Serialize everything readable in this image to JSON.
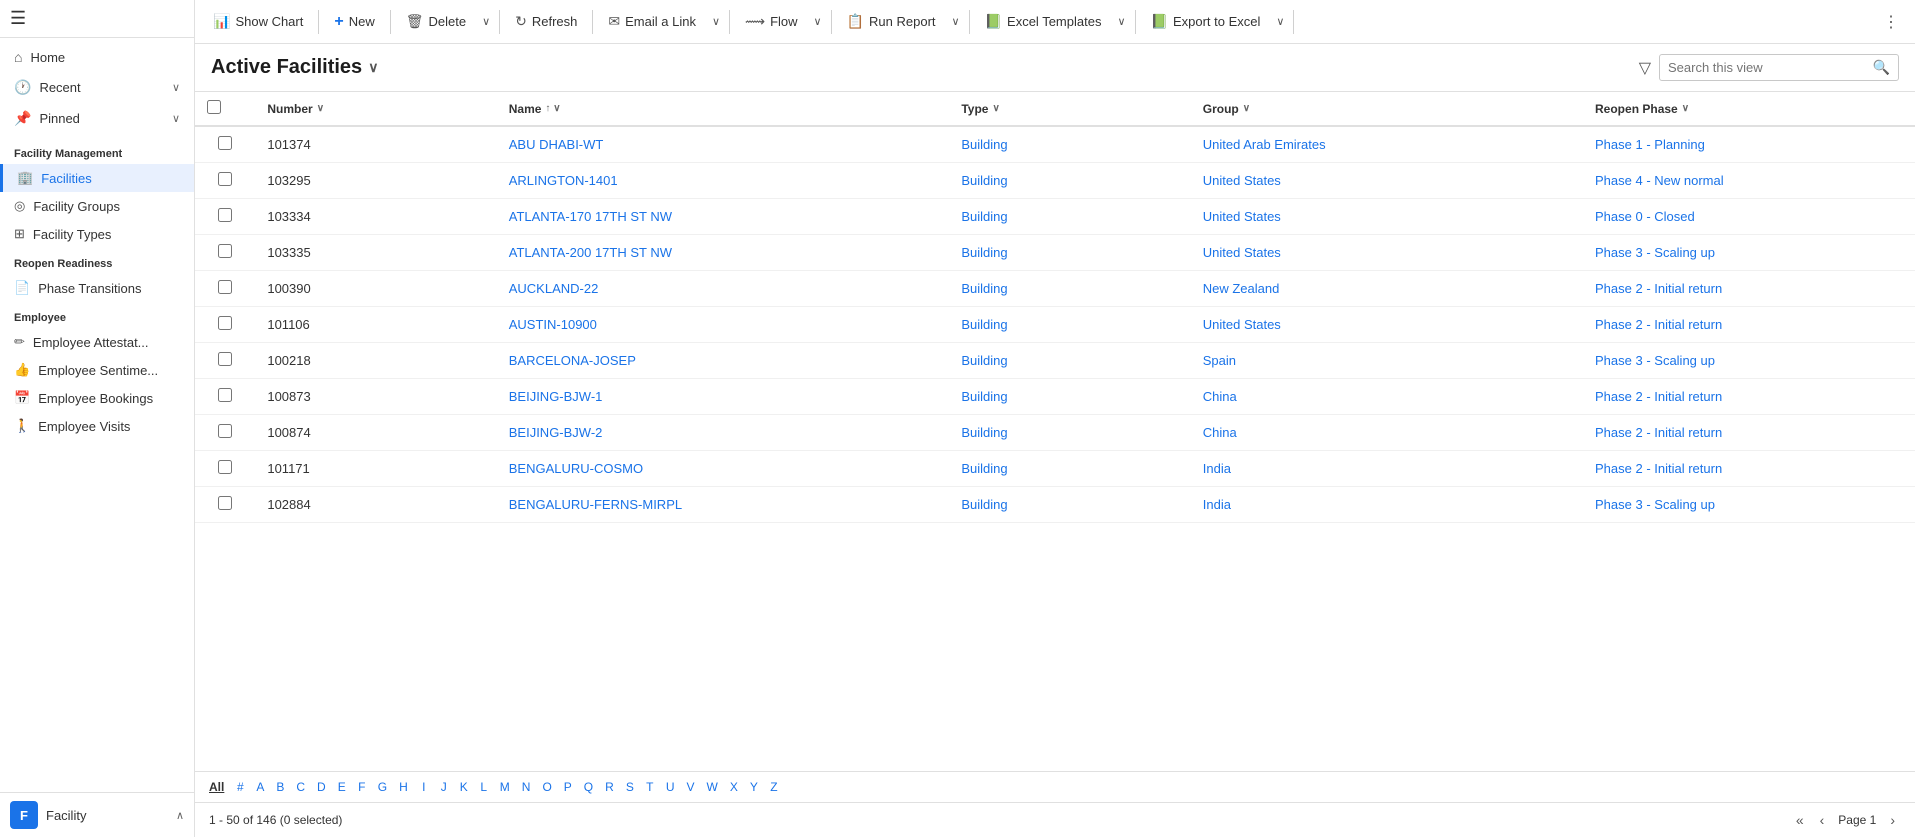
{
  "sidebar": {
    "hamburger": "☰",
    "nav_items": [
      {
        "id": "home",
        "label": "Home",
        "icon": "⌂"
      },
      {
        "id": "recent",
        "label": "Recent",
        "icon": "🕐",
        "chevron": "∨"
      },
      {
        "id": "pinned",
        "label": "Pinned",
        "icon": "📌",
        "chevron": "∨"
      }
    ],
    "sections": [
      {
        "label": "Facility Management",
        "items": [
          {
            "id": "facilities",
            "label": "Facilities",
            "icon": "🏢",
            "active": true
          },
          {
            "id": "facility-groups",
            "label": "Facility Groups",
            "icon": "◎"
          },
          {
            "id": "facility-types",
            "label": "Facility Types",
            "icon": "⊞"
          }
        ]
      },
      {
        "label": "Reopen Readiness",
        "items": [
          {
            "id": "phase-transitions",
            "label": "Phase Transitions",
            "icon": "📄"
          }
        ]
      },
      {
        "label": "Employee",
        "items": [
          {
            "id": "employee-attest",
            "label": "Employee Attestat...",
            "icon": "✏️"
          },
          {
            "id": "employee-senti",
            "label": "Employee Sentime...",
            "icon": "👍"
          },
          {
            "id": "employee-bookings",
            "label": "Employee Bookings",
            "icon": "📅"
          },
          {
            "id": "employee-visits",
            "label": "Employee Visits",
            "icon": "🚶"
          }
        ]
      }
    ],
    "footer": {
      "avatar_letter": "F",
      "label": "Facility",
      "chevron": "∧"
    }
  },
  "toolbar": {
    "buttons": [
      {
        "id": "show-chart",
        "label": "Show Chart",
        "icon": "📊"
      },
      {
        "id": "new",
        "label": "New",
        "icon": "+"
      },
      {
        "id": "delete",
        "label": "Delete",
        "icon": "🗑"
      },
      {
        "id": "refresh",
        "label": "Refresh",
        "icon": "↻"
      },
      {
        "id": "email-link",
        "label": "Email a Link",
        "icon": "✉"
      },
      {
        "id": "flow",
        "label": "Flow",
        "icon": "⟿"
      },
      {
        "id": "run-report",
        "label": "Run Report",
        "icon": "📋"
      },
      {
        "id": "excel-templates",
        "label": "Excel Templates",
        "icon": "📗"
      },
      {
        "id": "export-excel",
        "label": "Export to Excel",
        "icon": "📗"
      }
    ],
    "more_icon": "⋮"
  },
  "view": {
    "title": "Active Facilities",
    "title_chevron": "∨",
    "search_placeholder": "Search this view",
    "filter_icon": "▽"
  },
  "table": {
    "columns": [
      {
        "id": "check",
        "label": ""
      },
      {
        "id": "number",
        "label": "Number",
        "sortable": true,
        "sort": "∨"
      },
      {
        "id": "name",
        "label": "Name",
        "sortable": true,
        "sort": "↑ ∨"
      },
      {
        "id": "type",
        "label": "Type",
        "sortable": true,
        "sort": "∨"
      },
      {
        "id": "group",
        "label": "Group",
        "sortable": true,
        "sort": "∨"
      },
      {
        "id": "reopen_phase",
        "label": "Reopen Phase",
        "sortable": true,
        "sort": "∨"
      }
    ],
    "rows": [
      {
        "number": "101374",
        "name": "ABU DHABI-WT",
        "type": "Building",
        "group": "United Arab Emirates",
        "reopen_phase": "Phase 1 - Planning"
      },
      {
        "number": "103295",
        "name": "ARLINGTON-1401",
        "type": "Building",
        "group": "United States",
        "reopen_phase": "Phase 4 - New normal"
      },
      {
        "number": "103334",
        "name": "ATLANTA-170 17TH ST NW",
        "type": "Building",
        "group": "United States",
        "reopen_phase": "Phase 0 - Closed"
      },
      {
        "number": "103335",
        "name": "ATLANTA-200 17TH ST NW",
        "type": "Building",
        "group": "United States",
        "reopen_phase": "Phase 3 - Scaling up"
      },
      {
        "number": "100390",
        "name": "AUCKLAND-22",
        "type": "Building",
        "group": "New Zealand",
        "reopen_phase": "Phase 2 - Initial return"
      },
      {
        "number": "101106",
        "name": "AUSTIN-10900",
        "type": "Building",
        "group": "United States",
        "reopen_phase": "Phase 2 - Initial return"
      },
      {
        "number": "100218",
        "name": "BARCELONA-JOSEP",
        "type": "Building",
        "group": "Spain",
        "reopen_phase": "Phase 3 - Scaling up"
      },
      {
        "number": "100873",
        "name": "BEIJING-BJW-1",
        "type": "Building",
        "group": "China",
        "reopen_phase": "Phase 2 - Initial return"
      },
      {
        "number": "100874",
        "name": "BEIJING-BJW-2",
        "type": "Building",
        "group": "China",
        "reopen_phase": "Phase 2 - Initial return"
      },
      {
        "number": "101171",
        "name": "BENGALURU-COSMO",
        "type": "Building",
        "group": "India",
        "reopen_phase": "Phase 2 - Initial return"
      },
      {
        "number": "102884",
        "name": "BENGALURU-FERNS-MIRPL",
        "type": "Building",
        "group": "India",
        "reopen_phase": "Phase 3 - Scaling up"
      }
    ]
  },
  "alphabet": {
    "items": [
      "All",
      "#",
      "A",
      "B",
      "C",
      "D",
      "E",
      "F",
      "G",
      "H",
      "I",
      "J",
      "K",
      "L",
      "M",
      "N",
      "O",
      "P",
      "Q",
      "R",
      "S",
      "T",
      "U",
      "V",
      "W",
      "X",
      "Y",
      "Z"
    ],
    "active": "All"
  },
  "pagination": {
    "info": "1 - 50 of 146 (0 selected)",
    "page_label": "Page 1",
    "first_icon": "«",
    "prev_icon": "‹",
    "next_icon": "›"
  }
}
